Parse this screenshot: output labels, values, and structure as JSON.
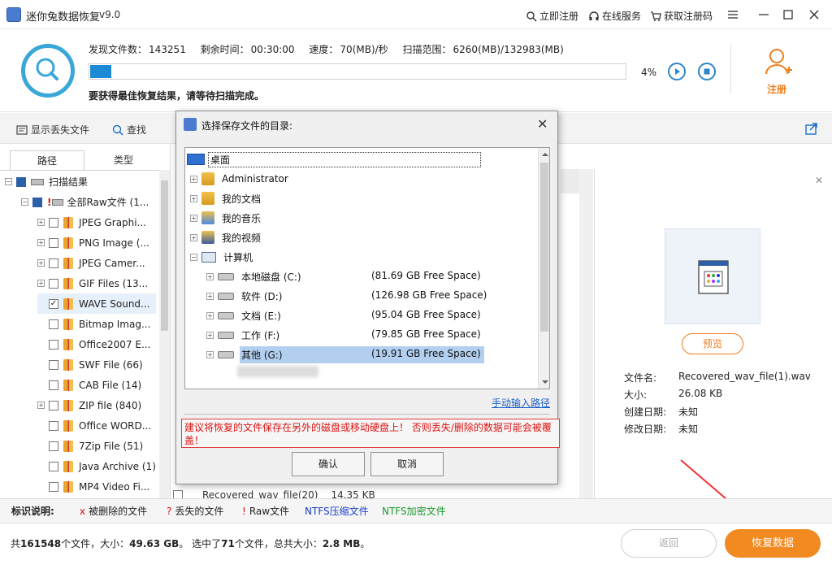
{
  "app": {
    "title": "迷你兔数据恢复",
    "version": "v9.0"
  },
  "titlebar": {
    "links": [
      "立即注册",
      "在线服务",
      "获取注册码"
    ]
  },
  "scan": {
    "found_label": "发现文件数：",
    "found_value": "143251",
    "remain_label": "剩余时间：",
    "remain_value": "00:30:00",
    "speed_label": "速度：",
    "speed_value": "70(MB)/秒",
    "range_label": "扫描范围：",
    "range_value": "6260(MB)/132983(MB)",
    "progress": 0.04,
    "progress_text": "4%",
    "hint": "要获得最佳恢复结果，请等待扫描完成。",
    "register_label": "注册"
  },
  "toolbar": {
    "show_lost": "显示丢失文件",
    "search": "查找"
  },
  "left_tabs": {
    "path": "路径",
    "type": "类型"
  },
  "tree": [
    {
      "label": "扫描结果"
    },
    {
      "label": "全部Raw文件 (1..."
    },
    {
      "label": "JPEG Graphi..."
    },
    {
      "label": "PNG Image (..."
    },
    {
      "label": "JPEG Camer..."
    },
    {
      "label": "GIF Files (13..."
    },
    {
      "label": "WAVE Sound..."
    },
    {
      "label": "Bitmap Imag..."
    },
    {
      "label": "Office2007 E..."
    },
    {
      "label": "SWF File (66)"
    },
    {
      "label": "CAB File (14)"
    },
    {
      "label": "ZIP file (840)"
    },
    {
      "label": "Office WORD..."
    },
    {
      "label": "7Zip File (51)"
    },
    {
      "label": "Java Archive (1)"
    },
    {
      "label": "MP4 Video Fi..."
    }
  ],
  "middle": {
    "bottom_row_name": "Recovered_wav_file(20)",
    "bottom_row_size": "14.35 KB"
  },
  "preview": {
    "button": "预览",
    "info": [
      {
        "label": "文件名:",
        "value": "Recovered_wav_file(1).wav"
      },
      {
        "label": "大小:",
        "value": "26.08 KB"
      },
      {
        "label": "创建日期:",
        "value": "未知"
      },
      {
        "label": "修改日期:",
        "value": "未知"
      }
    ]
  },
  "legend": {
    "title": "标识说明:",
    "items": [
      {
        "mark": "x",
        "text": "被删除的文件",
        "color": "#d11"
      },
      {
        "mark": "?",
        "text": "丢失的文件",
        "color": "#d11"
      },
      {
        "mark": "!",
        "text": "Raw文件",
        "color": "#d11"
      },
      {
        "mark": "",
        "text": "NTFS压缩文件",
        "color": "#1a3fc9"
      },
      {
        "mark": "",
        "text": "NTFS加密文件",
        "color": "#1a9a2a"
      }
    ]
  },
  "status": {
    "p1": "共",
    "total_files": "161548",
    "p2": "个文件，大小：",
    "total_size": "49.63 GB",
    "p3": "。  选中了",
    "selected_files": "71",
    "p4": "个文件，总共大小：",
    "selected_size": "2.8 MB",
    "p5": "。",
    "back": "返回",
    "recover": "恢复数据"
  },
  "dialog": {
    "title": "选择保存文件的目录:",
    "root": "桌面",
    "items": [
      {
        "label": "Administrator",
        "space": ""
      },
      {
        "label": "我的文档",
        "space": ""
      },
      {
        "label": "我的音乐",
        "space": ""
      },
      {
        "label": "我的视频",
        "space": ""
      },
      {
        "label": "计算机",
        "space": ""
      },
      {
        "label": "本地磁盘 (C:)",
        "space": "(81.69 GB Free Space)"
      },
      {
        "label": "软件 (D:)",
        "space": "(126.98 GB Free Space)"
      },
      {
        "label": "文档 (E:)",
        "space": "(95.04 GB Free Space)"
      },
      {
        "label": "工作 (F:)",
        "space": "(79.85 GB Free Space)"
      },
      {
        "label": "其他 (G:)",
        "space": "(19.91 GB Free Space)"
      }
    ],
    "manual_link": "手动输入路径",
    "warning": "建议将恢复的文件保存在另外的磁盘或移动硬盘上！ 否则丢失/删除的数据可能会被覆盖！",
    "ok": "确认",
    "cancel": "取消"
  },
  "colors": {
    "accent": "#1c8ad4",
    "orange": "#f08a21",
    "warning": "#e23a3a"
  }
}
